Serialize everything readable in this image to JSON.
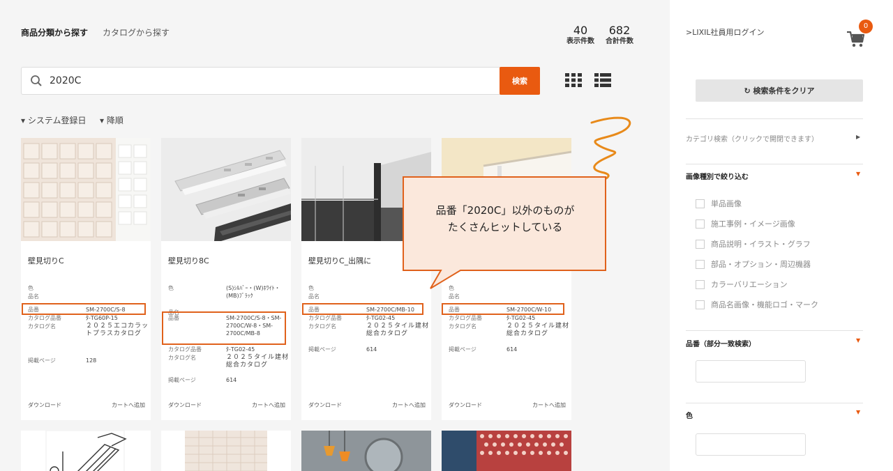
{
  "header": {
    "tab_product": "商品分類から探す",
    "tab_catalog": "カタログから探す",
    "display_count": "40",
    "display_count_label": "表示件数",
    "total_count": "682",
    "total_count_label": "合計件数"
  },
  "search": {
    "value": "2020C",
    "button_label": "検索"
  },
  "sort": {
    "field": "▾ システム登録日",
    "order": "▾ 降順"
  },
  "spec_labels": {
    "color": "色",
    "name": "品名",
    "part_no": "品番",
    "catalog_part_no": "カタログ品番",
    "catalog_name": "カタログ名",
    "page": "掲載ページ"
  },
  "card_actions": {
    "download": "ダウンロード",
    "add_to_cart": "カートへ追加"
  },
  "products": [
    {
      "title": "壁見切りC",
      "color": "",
      "part_no": "SM-2700C/S-8",
      "catalog_part_no": "ﾀ-TG60P-15",
      "catalog_name": "２０２５エコカラットプラスカタログ",
      "page": "128"
    },
    {
      "title": "壁見切り8C",
      "color": "(S)ｼﾙﾊﾞｰ・(W)ﾎﾜｲﾄ・(MB)ﾌﾞﾗｯｸ",
      "part_no": "SM-2700C/S-8・SM-2700C/W-8・SM-2700C/MB-8",
      "catalog_part_no": "ﾀ-TG02-45",
      "catalog_name": "２０２５タイル建材総合カタログ",
      "page": "614"
    },
    {
      "title": "壁見切りC_出隅に",
      "color": "",
      "part_no": "SM-2700C/MB-10",
      "catalog_part_no": "ﾀ-TG02-45",
      "catalog_name": "２０２５タイル建材総合カタログ",
      "page": "614"
    },
    {
      "title": "",
      "color": "",
      "part_no": "SM-2700C/W-10",
      "catalog_part_no": "ﾀ-TG02-45",
      "catalog_name": "２０２５タイル建材総合カタログ",
      "page": "614"
    }
  ],
  "callout": {
    "line1": "品番「2020C」以外のものが",
    "line2": "たくさんヒットしている"
  },
  "sidebar": {
    "login": ">LIXIL社員用ログイン",
    "cart_count": "0",
    "clear_button": "↻ 検索条件をクリア",
    "category_search": "カテゴリ検索（クリックで開閉できます）",
    "image_filter_heading": "画像種別で絞り込む",
    "image_filters": [
      "単品画像",
      "施工事例・イメージ画像",
      "商品説明・イラスト・グラフ",
      "部品・オプション・周辺機器",
      "カラーバリエーション",
      "商品名画像・機能ロゴ・マーク"
    ],
    "part_no_heading": "品番（部分一致検索）",
    "color_heading": "色"
  },
  "colors": {
    "accent": "#e95a10",
    "highlight": "#e0611b",
    "callout_fill": "#fbe8dc"
  }
}
